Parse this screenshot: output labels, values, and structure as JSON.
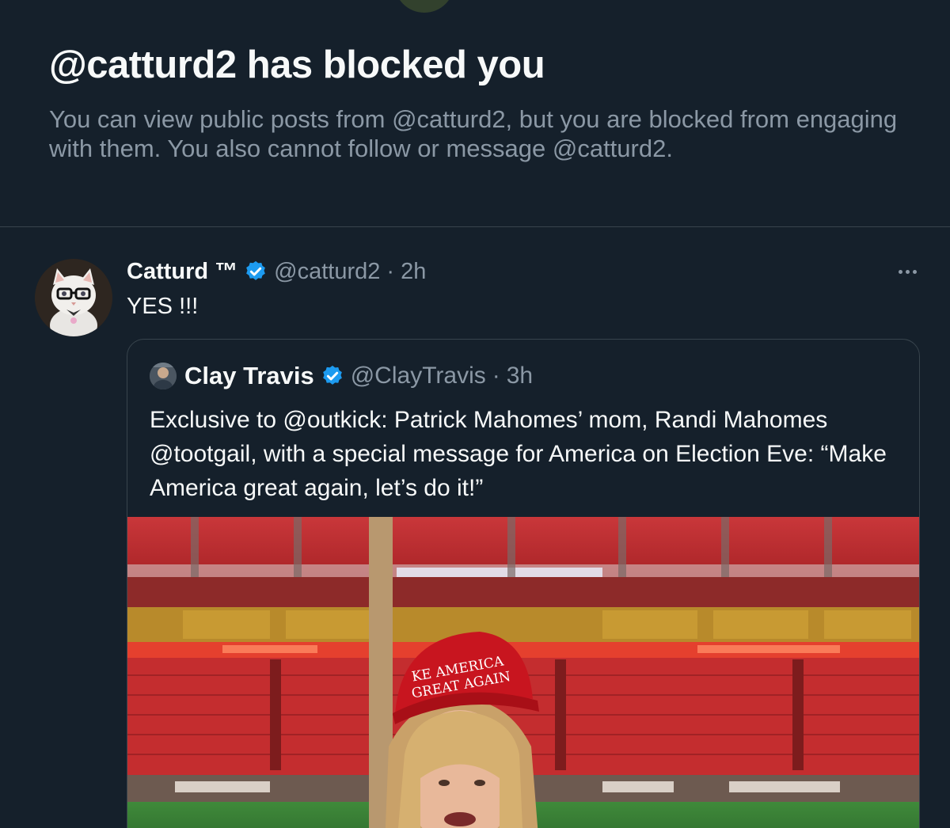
{
  "blocked_notice": {
    "title": "@catturd2 has blocked you",
    "description": "You can view public posts from @catturd2, but you are blocked from engaging with them. You also cannot follow or message @catturd2."
  },
  "tweet": {
    "display_name": "Catturd ™",
    "handle": "@catturd2",
    "separator": "·",
    "time": "2h",
    "text": "YES !!!",
    "avatar_icon": "cat-avatar-icon",
    "verified_icon": "verified-badge-icon",
    "more_icon": "more-options-icon"
  },
  "quoted_tweet": {
    "display_name": "Clay Travis",
    "handle": "@ClayTravis",
    "separator": "·",
    "time": "3h",
    "text": "Exclusive to @outkick: Patrick Mahomes’ mom, Randi Mahomes @tootgail, with a special message for America on Election Eve: “Make America great again, let’s do it!”",
    "media_icon": "video-thumbnail-stadium",
    "hat_text_line1": "KE AMERICA",
    "hat_text_line2": "GREAT AGAIN"
  },
  "colors": {
    "background": "#15202b",
    "primary_text": "#f7f9f9",
    "secondary_text": "#8b98a5",
    "border": "#38444d",
    "verified_blue": "#1d9bf0",
    "hat_red": "#c8151f"
  }
}
